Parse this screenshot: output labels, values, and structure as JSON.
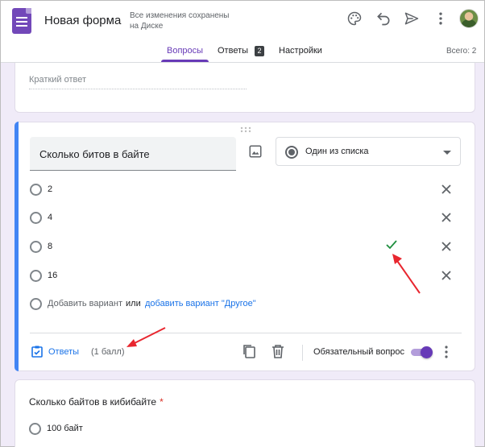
{
  "header": {
    "title": "Новая форма",
    "saved_status_line1": "Все изменения сохранены",
    "saved_status_line2": "на Диске",
    "icons": [
      "palette-icon",
      "undo-icon",
      "send-icon",
      "more-vert-icon"
    ]
  },
  "tabs": [
    {
      "label": "Вопросы",
      "active": true
    },
    {
      "label": "Ответы",
      "badge": "2"
    },
    {
      "label": "Настройки"
    }
  ],
  "total_points": "Всего: 2",
  "prev_question": {
    "placeholder": "Краткий ответ"
  },
  "question": {
    "text": "Сколько битов в байте",
    "type": "Один из списка",
    "options": [
      {
        "label": "2",
        "correct": false
      },
      {
        "label": "4",
        "correct": false
      },
      {
        "label": "8",
        "correct": true
      },
      {
        "label": "16",
        "correct": false
      }
    ],
    "add_option": "Добавить вариант",
    "or": "или",
    "add_other": "добавить вариант \"Другое\"",
    "answers_link": "Ответы",
    "points": "(1 балл)",
    "required_label": "Обязательный вопрос",
    "required": true
  },
  "next_question": {
    "text": "Сколько байтов в кибибайте",
    "required_mark": "*",
    "options": [
      "100 байт"
    ]
  },
  "colors": {
    "accent": "#673ab7",
    "active_card": "#4285f4",
    "link": "#1a73e8",
    "correct": "#1e8e3e",
    "annotation_arrow": "#e8262f"
  }
}
